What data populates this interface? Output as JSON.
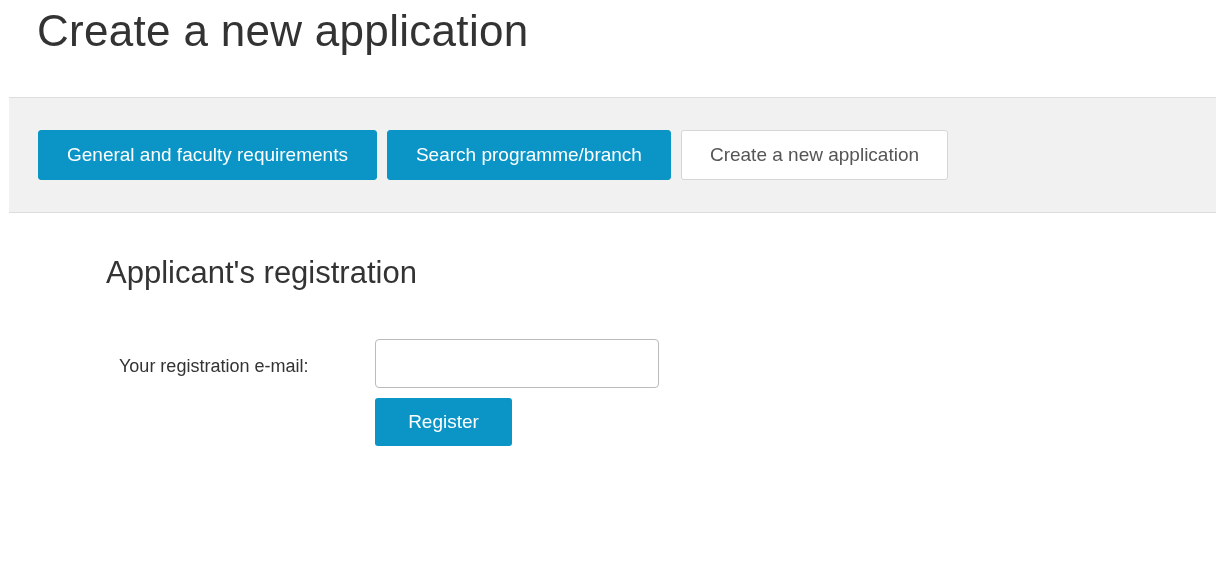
{
  "page_title": "Create a new application",
  "tabs": [
    {
      "label": "General and faculty requirements",
      "selected": false
    },
    {
      "label": "Search programme/branch",
      "selected": false
    },
    {
      "label": "Create a new application",
      "selected": true
    }
  ],
  "form": {
    "heading": "Applicant's registration",
    "email_label": "Your registration e-mail:",
    "submit": "Register"
  }
}
